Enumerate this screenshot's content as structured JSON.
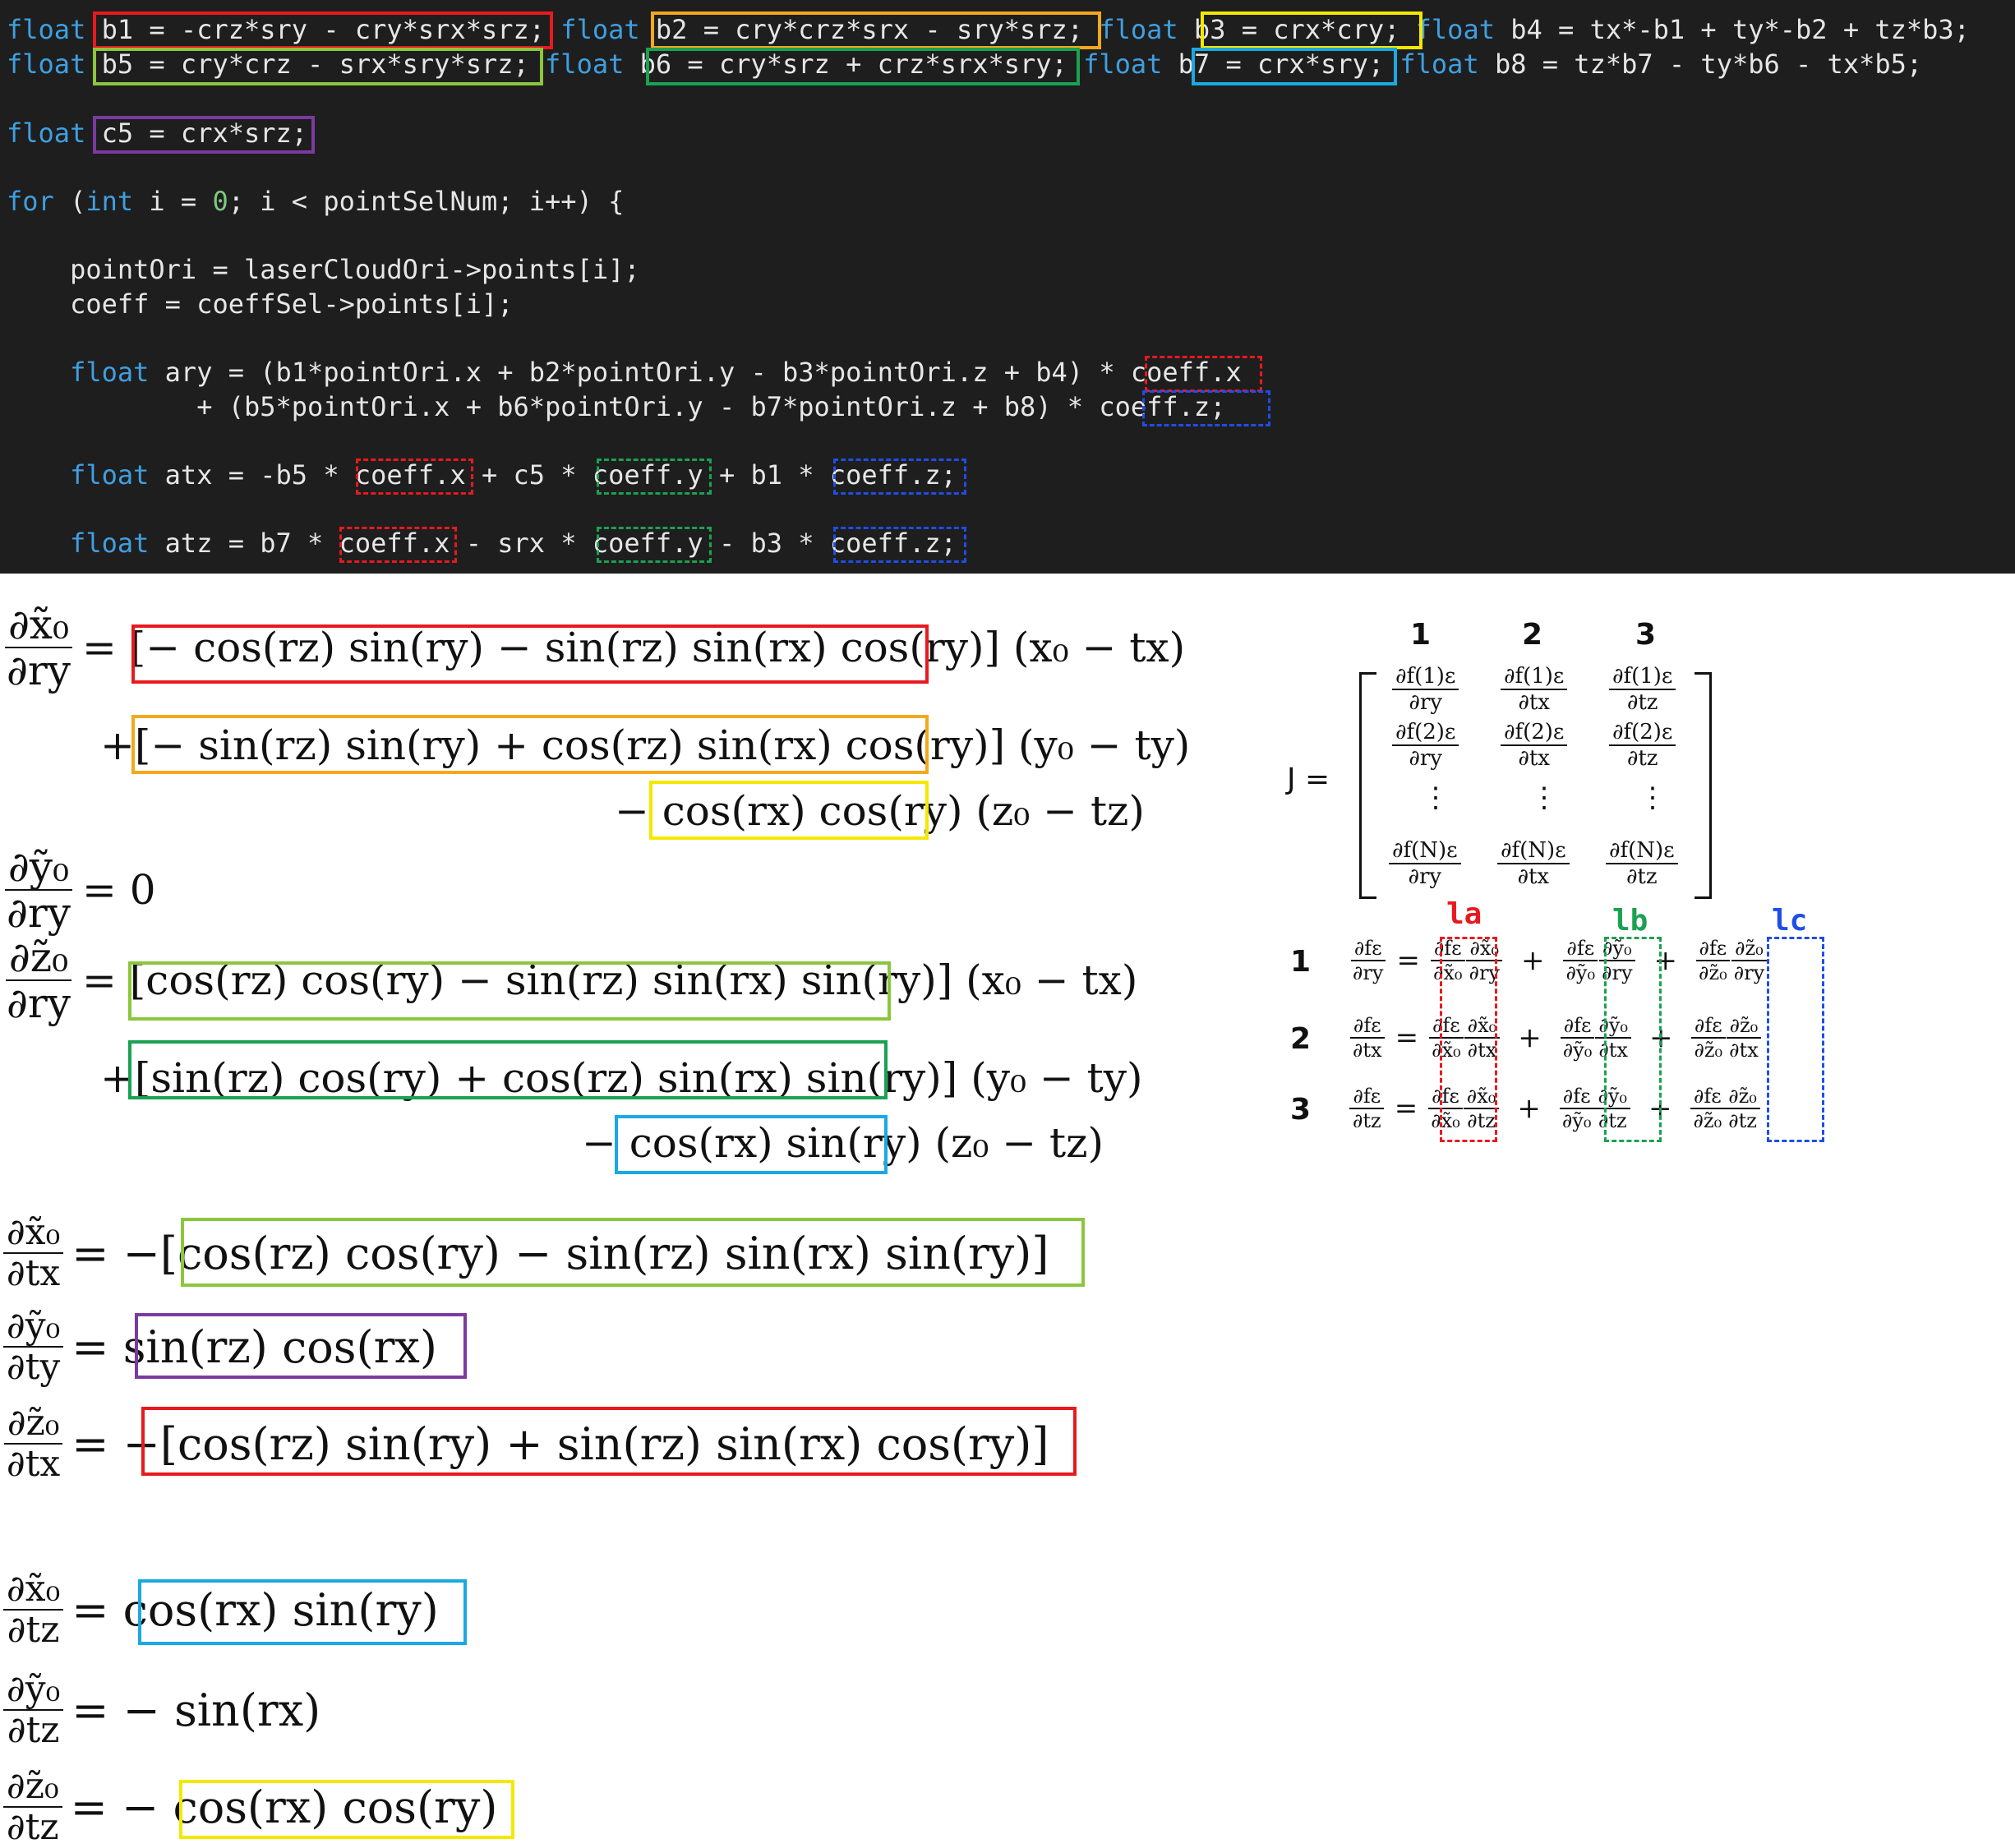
{
  "code": {
    "line1a": "float",
    "line1b": " b1 = -crz*sry - cry*srx*srz; ",
    "line1c": "float",
    "line1d": " b2 = cry*crz*srx - sry*srz; ",
    "line1e": "float",
    "line1f": " b3 = crx*cry; ",
    "line1g": "float",
    "line1h": " b4 = tx*-b1 + ty*-b2 + tz*b3;",
    "line2a": "float",
    "line2b": " b5 = cry*crz - srx*sry*srz; ",
    "line2c": "float",
    "line2d": " b6 = cry*srz + crz*srx*sry; ",
    "line2e": "float",
    "line2f": " b7 = crx*sry; ",
    "line2g": "float",
    "line2h": " b8 = tz*b7 - ty*b6 - tx*b5;",
    "line3a": "float",
    "line3b": " c5 = crx*srz;",
    "line4a": "for",
    "line4b": " (",
    "line4c": "int",
    "line4d": " i = ",
    "line4e": "0",
    "line4f": "; i < pointSelNum; i++) {",
    "line5": "    pointOri = laserCloudOri->points[i];",
    "line6": "    coeff = coeffSel->points[i];",
    "line7a": "    float",
    "line7b": " ary = (b1*pointOri.x + b2*pointOri.y - b3*pointOri.z + b4) * coeff.x",
    "line8": "            + (b5*pointOri.x + b6*pointOri.y - b7*pointOri.z + b8) * coeff.z;",
    "line9a": "    float",
    "line9b": " atx = -b5 * coeff.x + c5 * coeff.y + b1 * coeff.z;",
    "line10a": "    float",
    "line10b": " atz = b7 * coeff.x - srx * coeff.y - b3 * coeff.z;"
  },
  "equations": {
    "e1_num": "∂x̃₀",
    "e1_den": "∂ry",
    "e1_rhs1": "= [− cos(rz) sin(ry) − sin(rz) sin(rx) cos(ry)] (x₀ − tx)",
    "e1_rhs2": "+[− sin(rz) sin(ry) + cos(rz) sin(rx) cos(ry)] (y₀ − ty)",
    "e1_rhs3": "− cos(rx) cos(ry) (z₀ − tz)",
    "e2_num": "∂ỹ₀",
    "e2_den": "∂ry",
    "e2_rhs": "= 0",
    "e3_num": "∂z̃₀",
    "e3_den": "∂ry",
    "e3_rhs1": "= [cos(rz) cos(ry) − sin(rz) sin(rx) sin(ry)] (x₀ − tx)",
    "e3_rhs2": "+[sin(rz) cos(ry) + cos(rz) sin(rx) sin(ry)] (y₀ − ty)",
    "e3_rhs3": "− cos(rx) sin(ry) (z₀ − tz)",
    "e4_num": "∂x̃₀",
    "e4_den": "∂tx",
    "e4_rhs": "= −[cos(rz) cos(ry) − sin(rz) sin(rx) sin(ry)]",
    "e5_num": "∂ỹ₀",
    "e5_den": "∂ty",
    "e5_rhs": "= sin(rz) cos(rx)",
    "e6_num": "∂z̃₀",
    "e6_den": "∂tx",
    "e6_rhs": "= −[cos(rz) sin(ry) + sin(rz) sin(rx) cos(ry)]",
    "e7_num": "∂x̃₀",
    "e7_den": "∂tz",
    "e7_rhs": "= cos(rx) sin(ry)",
    "e8_num": "∂ỹ₀",
    "e8_den": "∂tz",
    "e8_rhs": "= − sin(rx)",
    "e9_num": "∂z̃₀",
    "e9_den": "∂tz",
    "e9_rhs": "= − cos(rx) cos(ry)"
  },
  "jacobian": {
    "label": "J =",
    "col1": "1",
    "col2": "2",
    "col3": "3",
    "r1c1_num": "∂f(1)ε",
    "r1c1_den": "∂ry",
    "r1c2_num": "∂f(1)ε",
    "r1c2_den": "∂tx",
    "r1c3_num": "∂f(1)ε",
    "r1c3_den": "∂tz",
    "r2c1_num": "∂f(2)ε",
    "r2c1_den": "∂ry",
    "r2c2_num": "∂f(2)ε",
    "r2c2_den": "∂tx",
    "r2c3_num": "∂f(2)ε",
    "r2c3_den": "∂tz",
    "dots": "⋮",
    "rNc1_num": "∂f(N)ε",
    "rNc1_den": "∂ry",
    "rNc2_num": "∂f(N)ε",
    "rNc2_den": "∂tx",
    "rNc3_num": "∂f(N)ε",
    "rNc3_den": "∂tz"
  },
  "chain": {
    "la": "la",
    "lb": "lb",
    "lc": "lc",
    "row1_label": "1",
    "row2_label": "2",
    "row3_label": "3",
    "df": "∂fε",
    "dx": "∂x̃₀",
    "dy": "∂ỹ₀",
    "dz": "∂z̃₀",
    "ry": "∂ry",
    "tx": "∂tx",
    "tz": "∂tz",
    "eq": "=",
    "plus": "+"
  },
  "colors": {
    "red": "#e8191f",
    "orange": "#f5a81c",
    "yellow": "#f4e800",
    "lime": "#8cc63e",
    "green": "#1aa152",
    "sky": "#1aa9e1",
    "purple": "#7a3aa0",
    "blue": "#1f4de8",
    "keyword": "#3f9fe0",
    "code_bg": "#1e1e1e"
  }
}
